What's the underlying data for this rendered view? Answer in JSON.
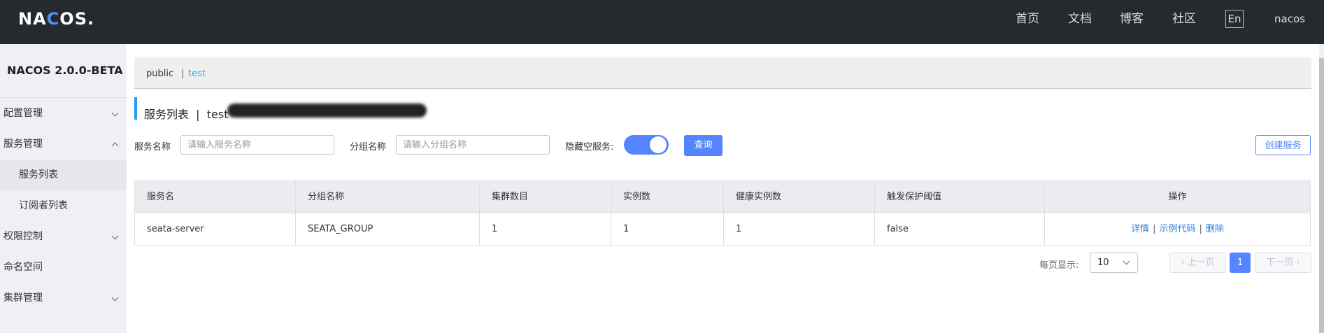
{
  "header": {
    "logo": "NACOS.",
    "nav": [
      "首页",
      "文档",
      "博客",
      "社区"
    ],
    "lang": "En",
    "user": "nacos"
  },
  "sidebar": {
    "title": "NACOS 2.0.0-BETA",
    "items": [
      {
        "label": "配置管理",
        "expanded": false
      },
      {
        "label": "服务管理",
        "expanded": true
      },
      {
        "label": "服务列表",
        "sub": true,
        "active": true
      },
      {
        "label": "订阅者列表",
        "sub": true
      },
      {
        "label": "权限控制",
        "expanded": false
      },
      {
        "label": "命名空间"
      },
      {
        "label": "集群管理",
        "expanded": false
      }
    ]
  },
  "namespaces": {
    "public": "public",
    "separator": "|",
    "current": "test"
  },
  "page": {
    "title": "服务列表  |  test"
  },
  "filters": {
    "service_label": "服务名称",
    "service_placeholder": "请输入服务名称",
    "group_label": "分组名称",
    "group_placeholder": "请输入分组名称",
    "hide_empty_label": "隐藏空服务:",
    "hide_empty_on": true,
    "query_button": "查询",
    "create_button": "创建服务"
  },
  "table": {
    "columns": [
      "服务名",
      "分组名称",
      "集群数目",
      "实例数",
      "健康实例数",
      "触发保护阈值",
      "操作"
    ],
    "rows": [
      {
        "service": "seata-server",
        "group": "SEATA_GROUP",
        "clusters": "1",
        "instances": "1",
        "healthy": "1",
        "threshold": "false"
      }
    ],
    "actions": [
      "详情",
      "示例代码",
      "删除"
    ]
  },
  "pagination": {
    "per_page_label": "每页显示:",
    "page_size": "10",
    "prev": "上一页",
    "next": "下一页",
    "current": "1"
  },
  "colors": {
    "accent": "#5584ff",
    "link": "#2d7bd6",
    "header_bg": "#252a2f"
  }
}
